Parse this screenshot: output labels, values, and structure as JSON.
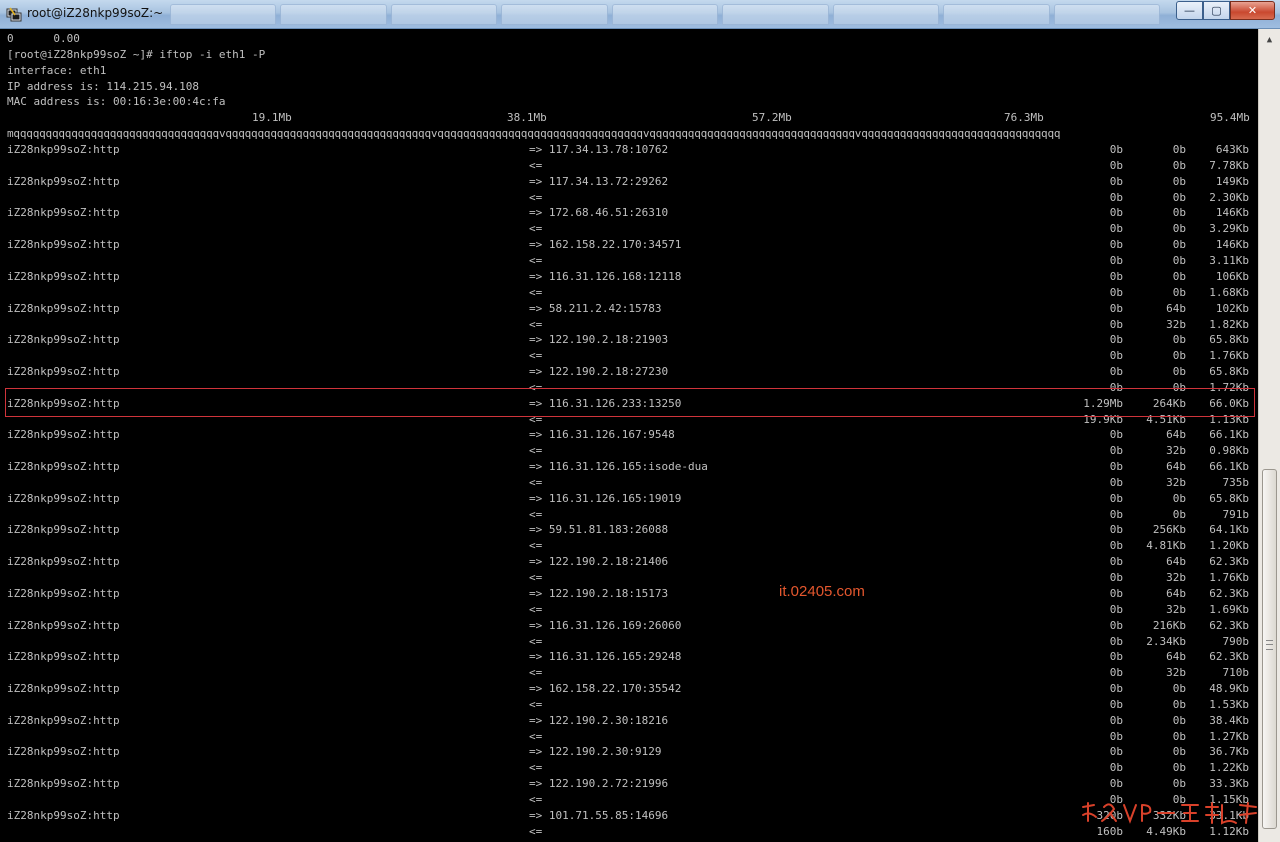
{
  "window": {
    "title": "root@iZ28nkp99soZ:~",
    "background_tabs": [
      "",
      "",
      "",
      "",
      "",
      "",
      "",
      "",
      ""
    ],
    "controls": {
      "minimize": "—",
      "maximize": "▢",
      "close": "✕"
    }
  },
  "terminal": {
    "header_lines": [
      "0      0.00",
      "[root@iZ28nkp99soZ ~]# iftop -i eth1 -P",
      "interface: eth1",
      "IP address is: 114.215.94.108",
      "MAC address is: 00:16:3e:00:4c:fa"
    ],
    "scale_labels": [
      "19.1Mb",
      "38.1Mb",
      "57.2Mb",
      "76.3Mb",
      "95.4Mb"
    ],
    "separator": "mqqqqqqqqqqqqqqqqqqqqqqqqqqqqqqqqvqqqqqqqqqqqqqqqqqqqqqqqqqqqqqqqqvqqqqqqqqqqqqqqqqqqqqqqqqqqqqqqqqvqqqqqqqqqqqqqqqqqqqqqqqqqqqqqqqqvqqqqqqqqqqqqqqqqqqqqqqqqqqqqqqq",
    "send_arrow": "=>",
    "recv_arrow": "<=",
    "connections": [
      {
        "src": "iZ28nkp99soZ:http",
        "dst": "117.34.13.78:10762",
        "out": [
          "0b",
          "0b",
          "643Kb"
        ],
        "in": [
          "0b",
          "0b",
          "7.78Kb"
        ]
      },
      {
        "src": "iZ28nkp99soZ:http",
        "dst": "117.34.13.72:29262",
        "out": [
          "0b",
          "0b",
          "149Kb"
        ],
        "in": [
          "0b",
          "0b",
          "2.30Kb"
        ]
      },
      {
        "src": "iZ28nkp99soZ:http",
        "dst": "172.68.46.51:26310",
        "out": [
          "0b",
          "0b",
          "146Kb"
        ],
        "in": [
          "0b",
          "0b",
          "3.29Kb"
        ]
      },
      {
        "src": "iZ28nkp99soZ:http",
        "dst": "162.158.22.170:34571",
        "out": [
          "0b",
          "0b",
          "146Kb"
        ],
        "in": [
          "0b",
          "0b",
          "3.11Kb"
        ]
      },
      {
        "src": "iZ28nkp99soZ:http",
        "dst": "116.31.126.168:12118",
        "out": [
          "0b",
          "0b",
          "106Kb"
        ],
        "in": [
          "0b",
          "0b",
          "1.68Kb"
        ]
      },
      {
        "src": "iZ28nkp99soZ:http",
        "dst": "58.211.2.42:15783",
        "out": [
          "0b",
          "64b",
          "102Kb"
        ],
        "in": [
          "0b",
          "32b",
          "1.82Kb"
        ]
      },
      {
        "src": "iZ28nkp99soZ:http",
        "dst": "122.190.2.18:21903",
        "out": [
          "0b",
          "0b",
          "65.8Kb"
        ],
        "in": [
          "0b",
          "0b",
          "1.76Kb"
        ]
      },
      {
        "src": "iZ28nkp99soZ:http",
        "dst": "122.190.2.18:27230",
        "out": [
          "0b",
          "0b",
          "65.8Kb"
        ],
        "in": [
          "0b",
          "0b",
          "1.72Kb"
        ]
      },
      {
        "src": "iZ28nkp99soZ:http",
        "dst": "116.31.126.233:13250",
        "out": [
          "1.29Mb",
          "264Kb",
          "66.0Kb"
        ],
        "in": [
          "19.9Kb",
          "4.51Kb",
          "1.13Kb"
        ],
        "highlighted": true
      },
      {
        "src": "iZ28nkp99soZ:http",
        "dst": "116.31.126.167:9548",
        "out": [
          "0b",
          "64b",
          "66.1Kb"
        ],
        "in": [
          "0b",
          "32b",
          "0.98Kb"
        ]
      },
      {
        "src": "iZ28nkp99soZ:http",
        "dst": "116.31.126.165:isode-dua",
        "out": [
          "0b",
          "64b",
          "66.1Kb"
        ],
        "in": [
          "0b",
          "32b",
          "735b"
        ]
      },
      {
        "src": "iZ28nkp99soZ:http",
        "dst": "116.31.126.165:19019",
        "out": [
          "0b",
          "0b",
          "65.8Kb"
        ],
        "in": [
          "0b",
          "0b",
          "791b"
        ]
      },
      {
        "src": "iZ28nkp99soZ:http",
        "dst": "59.51.81.183:26088",
        "out": [
          "0b",
          "256Kb",
          "64.1Kb"
        ],
        "in": [
          "0b",
          "4.81Kb",
          "1.20Kb"
        ]
      },
      {
        "src": "iZ28nkp99soZ:http",
        "dst": "122.190.2.18:21406",
        "out": [
          "0b",
          "64b",
          "62.3Kb"
        ],
        "in": [
          "0b",
          "32b",
          "1.76Kb"
        ]
      },
      {
        "src": "iZ28nkp99soZ:http",
        "dst": "122.190.2.18:15173",
        "out": [
          "0b",
          "64b",
          "62.3Kb"
        ],
        "in": [
          "0b",
          "32b",
          "1.69Kb"
        ]
      },
      {
        "src": "iZ28nkp99soZ:http",
        "dst": "116.31.126.169:26060",
        "out": [
          "0b",
          "216Kb",
          "62.3Kb"
        ],
        "in": [
          "0b",
          "2.34Kb",
          "790b"
        ]
      },
      {
        "src": "iZ28nkp99soZ:http",
        "dst": "116.31.126.165:29248",
        "out": [
          "0b",
          "64b",
          "62.3Kb"
        ],
        "in": [
          "0b",
          "32b",
          "710b"
        ]
      },
      {
        "src": "iZ28nkp99soZ:http",
        "dst": "162.158.22.170:35542",
        "out": [
          "0b",
          "0b",
          "48.9Kb"
        ],
        "in": [
          "0b",
          "0b",
          "1.53Kb"
        ]
      },
      {
        "src": "iZ28nkp99soZ:http",
        "dst": "122.190.2.30:18216",
        "out": [
          "0b",
          "0b",
          "38.4Kb"
        ],
        "in": [
          "0b",
          "0b",
          "1.27Kb"
        ]
      },
      {
        "src": "iZ28nkp99soZ:http",
        "dst": "122.190.2.30:9129",
        "out": [
          "0b",
          "0b",
          "36.7Kb"
        ],
        "in": [
          "0b",
          "0b",
          "1.22Kb"
        ]
      },
      {
        "src": "iZ28nkp99soZ:http",
        "dst": "122.190.2.72:21996",
        "out": [
          "0b",
          "0b",
          "33.3Kb"
        ],
        "in": [
          "0b",
          "0b",
          "1.15Kb"
        ]
      },
      {
        "src": "iZ28nkp99soZ:http",
        "dst": "101.71.55.85:14696",
        "out": [
          "320b",
          "332Kb",
          "33.1Kb"
        ],
        "in": [
          "160b",
          "4.49Kb",
          "1.12Kb"
        ]
      }
    ]
  },
  "overlay": {
    "watermark": "it.02405.com",
    "highlight_color": "#d0343b",
    "watermark_color": "#e4572e"
  },
  "colors": {
    "terminal_bg": "#000000",
    "terminal_fg": "#c0c0c0",
    "titlebar": "#a8c3e0"
  }
}
